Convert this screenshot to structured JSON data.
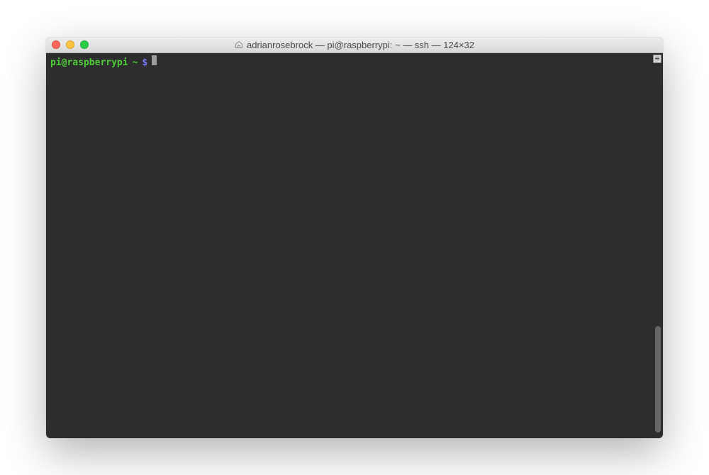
{
  "window": {
    "title": "adrianrosebrock — pi@raspberrypi: ~ — ssh — 124×32"
  },
  "terminal": {
    "prompt": {
      "user_host": "pi@raspberrypi",
      "path": "~",
      "symbol": "$"
    },
    "colors": {
      "background": "#2d2d2d",
      "prompt_green": "#4fce3a",
      "prompt_symbol": "#7c7cff",
      "cursor": "#9c9c9c"
    }
  }
}
